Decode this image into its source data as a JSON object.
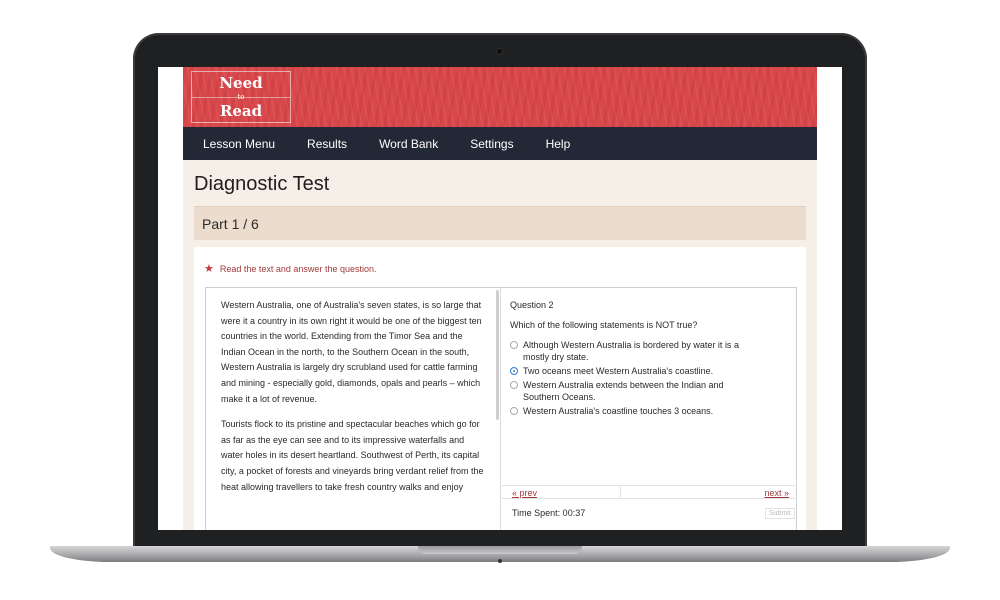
{
  "logo": {
    "line1": "Need",
    "line2": "to",
    "line3": "Read"
  },
  "nav": {
    "items": [
      "Lesson Menu",
      "Results",
      "Word Bank",
      "Settings",
      "Help"
    ]
  },
  "page": {
    "title": "Diagnostic Test",
    "part": "Part 1 / 6"
  },
  "instruction": {
    "text": "Read the text and answer the question."
  },
  "passage": {
    "paragraphs": [
      "Western Australia, one of Australia's seven states, is so large that were it a country in its own right it would be one of the biggest ten countries in the world. Extending from the Timor Sea and the Indian Ocean in the north, to the Southern Ocean in the south, Western Australia is largely dry scrubland used for cattle farming and mining - especially gold, diamonds, opals and pearls – which make it a lot of revenue.",
      "Tourists flock to its pristine and spectacular beaches which go for as far as the eye can see and to its impressive waterfalls and water holes in its desert heartland. Southwest of Perth, its capital city, a pocket of forests and vineyards bring verdant relief from the heat allowing travellers to take fresh country walks and enjoy"
    ]
  },
  "question": {
    "number": "Question 2",
    "prompt": "Which of the following statements is NOT true?",
    "options": [
      "Although Western Australia is bordered by water it is a mostly dry state.",
      "Two oceans meet Western Australia's coastline.",
      "Western Australia extends between the Indian and Southern Oceans.",
      "Western Australia's coastline touches 3 oceans."
    ],
    "selected_index": 1
  },
  "pager": {
    "prev": "« prev",
    "next": "next »"
  },
  "timer": {
    "text": "Time Spent: 00:37"
  },
  "submit": {
    "label": "Submit"
  },
  "colors": {
    "banner": "#d9474b",
    "nav": "#232836",
    "accent": "#a23b3b",
    "radio_selected": "#3b7fd9"
  }
}
